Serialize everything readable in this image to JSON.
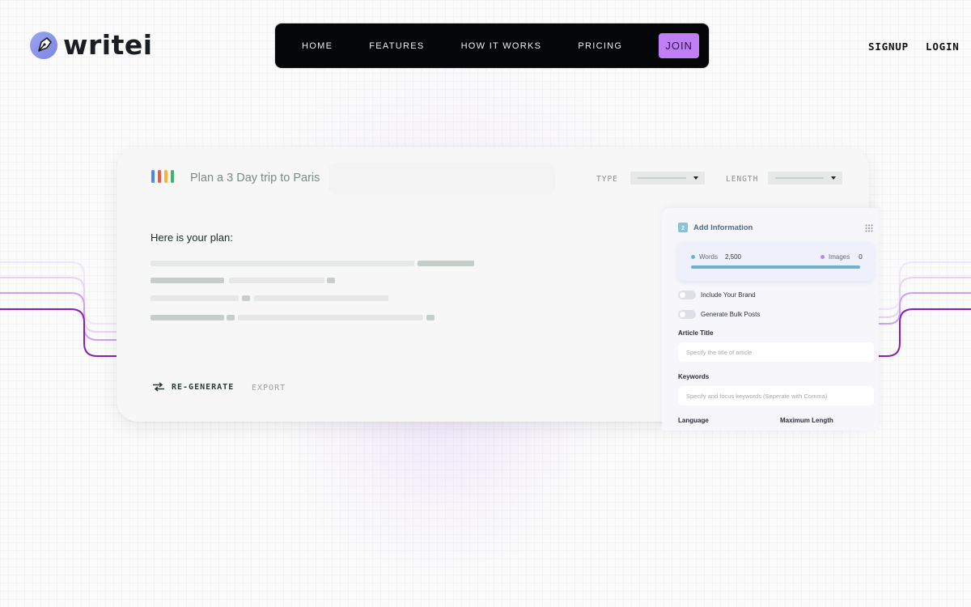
{
  "brand": {
    "name": "writei"
  },
  "nav": {
    "items": [
      "HOME",
      "FEATURES",
      "HOW IT WORKS",
      "PRICING"
    ],
    "cta": "JOIN"
  },
  "auth": {
    "signup": "SIGNUP",
    "login": "LOGIN"
  },
  "colors": {
    "accent": "#c07ef5",
    "nav_bg": "#050607",
    "google_blue": "#4f86e8",
    "google_red": "#e35b4f",
    "google_yellow": "#f3b43d",
    "google_green": "#46b16b",
    "stat_bar": "#6fb1cb"
  },
  "editor": {
    "prompt": "Plan a 3 Day trip to Paris",
    "type_label": "TYPE",
    "length_label": "LENGTH",
    "result_heading": "Here is your plan:",
    "regenerate_label": "RE-GENERATE",
    "export_label": "EXPORT"
  },
  "panel": {
    "step": "2",
    "title": "Add Information",
    "words_label": "Words",
    "words_value": "2,500",
    "images_label": "Images",
    "images_value": "0",
    "toggle_brand": "Include Your Brand",
    "toggle_bulk": "Generate Bulk Posts",
    "article_title_label": "Article Title",
    "article_title_placeholder": "Specify the title of article",
    "keywords_label": "Keywords",
    "keywords_placeholder": "Specify and focus keywords (Seperate with Comma)",
    "language_label": "Language",
    "max_length_label": "Maximum Length"
  },
  "icons": {
    "logo": "pen-nib-icon",
    "regenerate": "swap-arrows-icon",
    "panel_menu": "grid-dots-icon"
  }
}
